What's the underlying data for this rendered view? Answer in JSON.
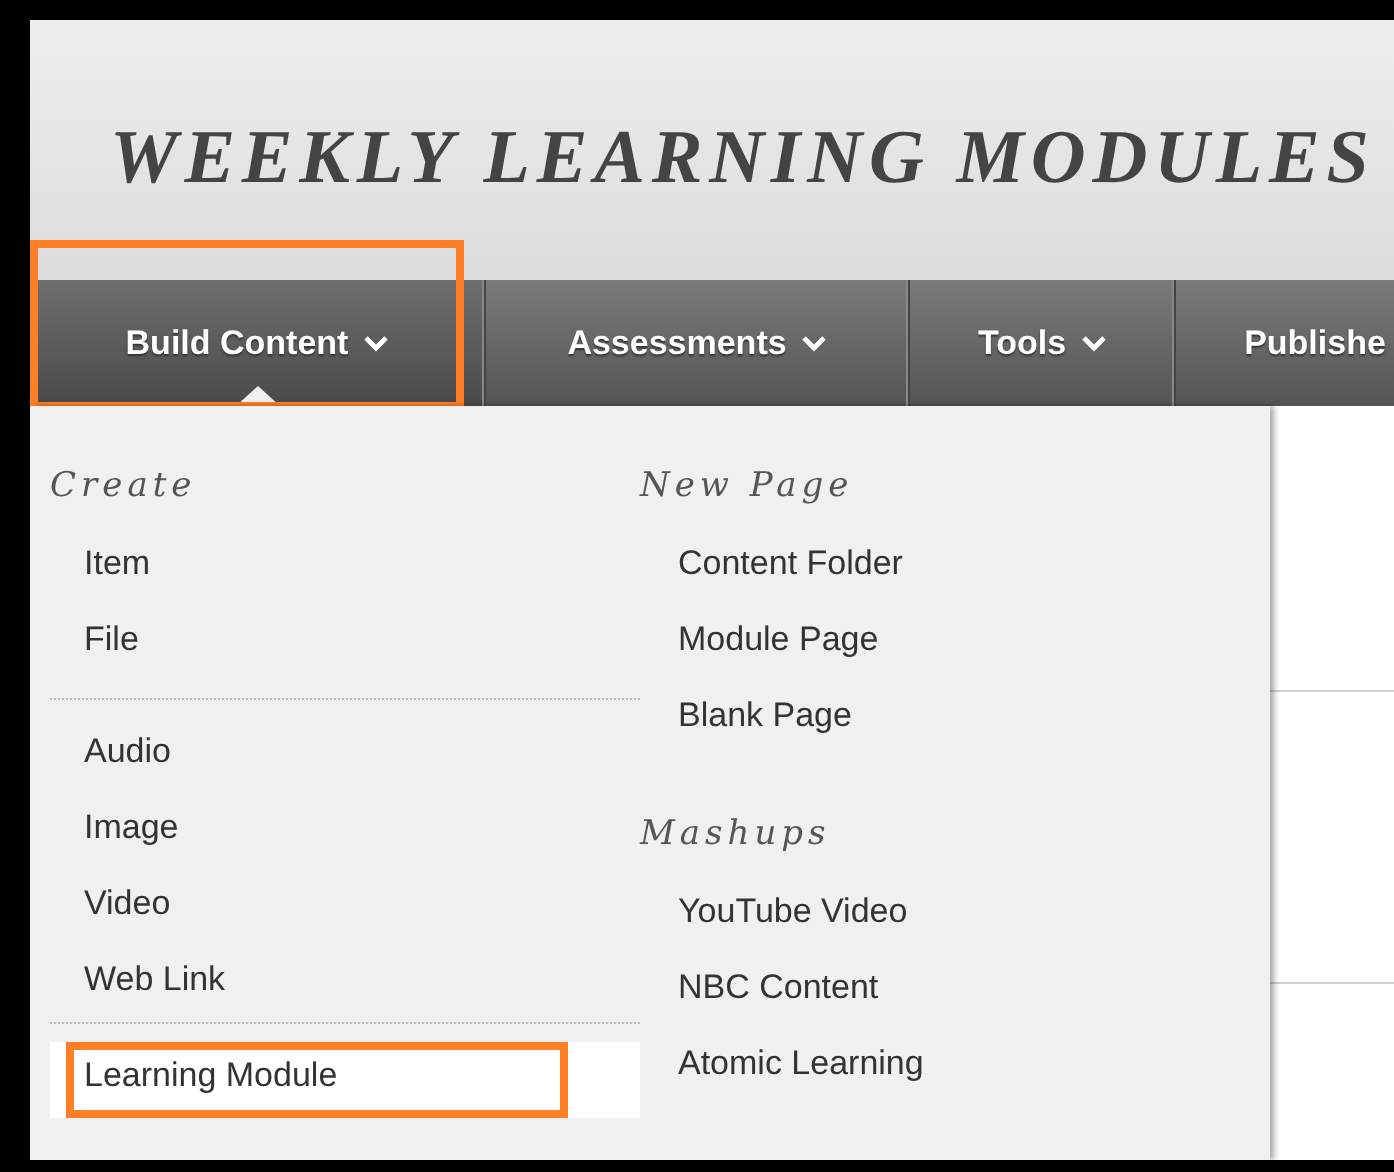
{
  "title": "WEEKLY LEARNING MODULES",
  "nav": [
    {
      "label": "Build Content",
      "selected": true,
      "highlighted": true
    },
    {
      "label": "Assessments",
      "selected": false,
      "highlighted": false
    },
    {
      "label": "Tools",
      "selected": false,
      "highlighted": false
    },
    {
      "label": "Publishe",
      "selected": false,
      "highlighted": false
    }
  ],
  "menu": {
    "columns": [
      {
        "sections": [
          {
            "heading": "Create",
            "groups": [
              [
                {
                  "label": "Item",
                  "highlighted": false
                },
                {
                  "label": "File",
                  "highlighted": false
                }
              ],
              [
                {
                  "label": "Audio",
                  "highlighted": false
                },
                {
                  "label": "Image",
                  "highlighted": false
                },
                {
                  "label": "Video",
                  "highlighted": false
                },
                {
                  "label": "Web Link",
                  "highlighted": false
                }
              ],
              [
                {
                  "label": "Learning Module",
                  "highlighted": true
                }
              ]
            ]
          }
        ]
      },
      {
        "sections": [
          {
            "heading": "New Page",
            "groups": [
              [
                {
                  "label": "Content Folder",
                  "highlighted": false
                },
                {
                  "label": "Module Page",
                  "highlighted": false
                },
                {
                  "label": "Blank Page",
                  "highlighted": false
                }
              ]
            ]
          },
          {
            "heading": "Mashups",
            "groups": [
              [
                {
                  "label": "YouTube Video",
                  "highlighted": false
                },
                {
                  "label": "NBC Content",
                  "highlighted": false
                },
                {
                  "label": "Atomic Learning",
                  "highlighted": false
                }
              ]
            ]
          }
        ]
      }
    ]
  }
}
